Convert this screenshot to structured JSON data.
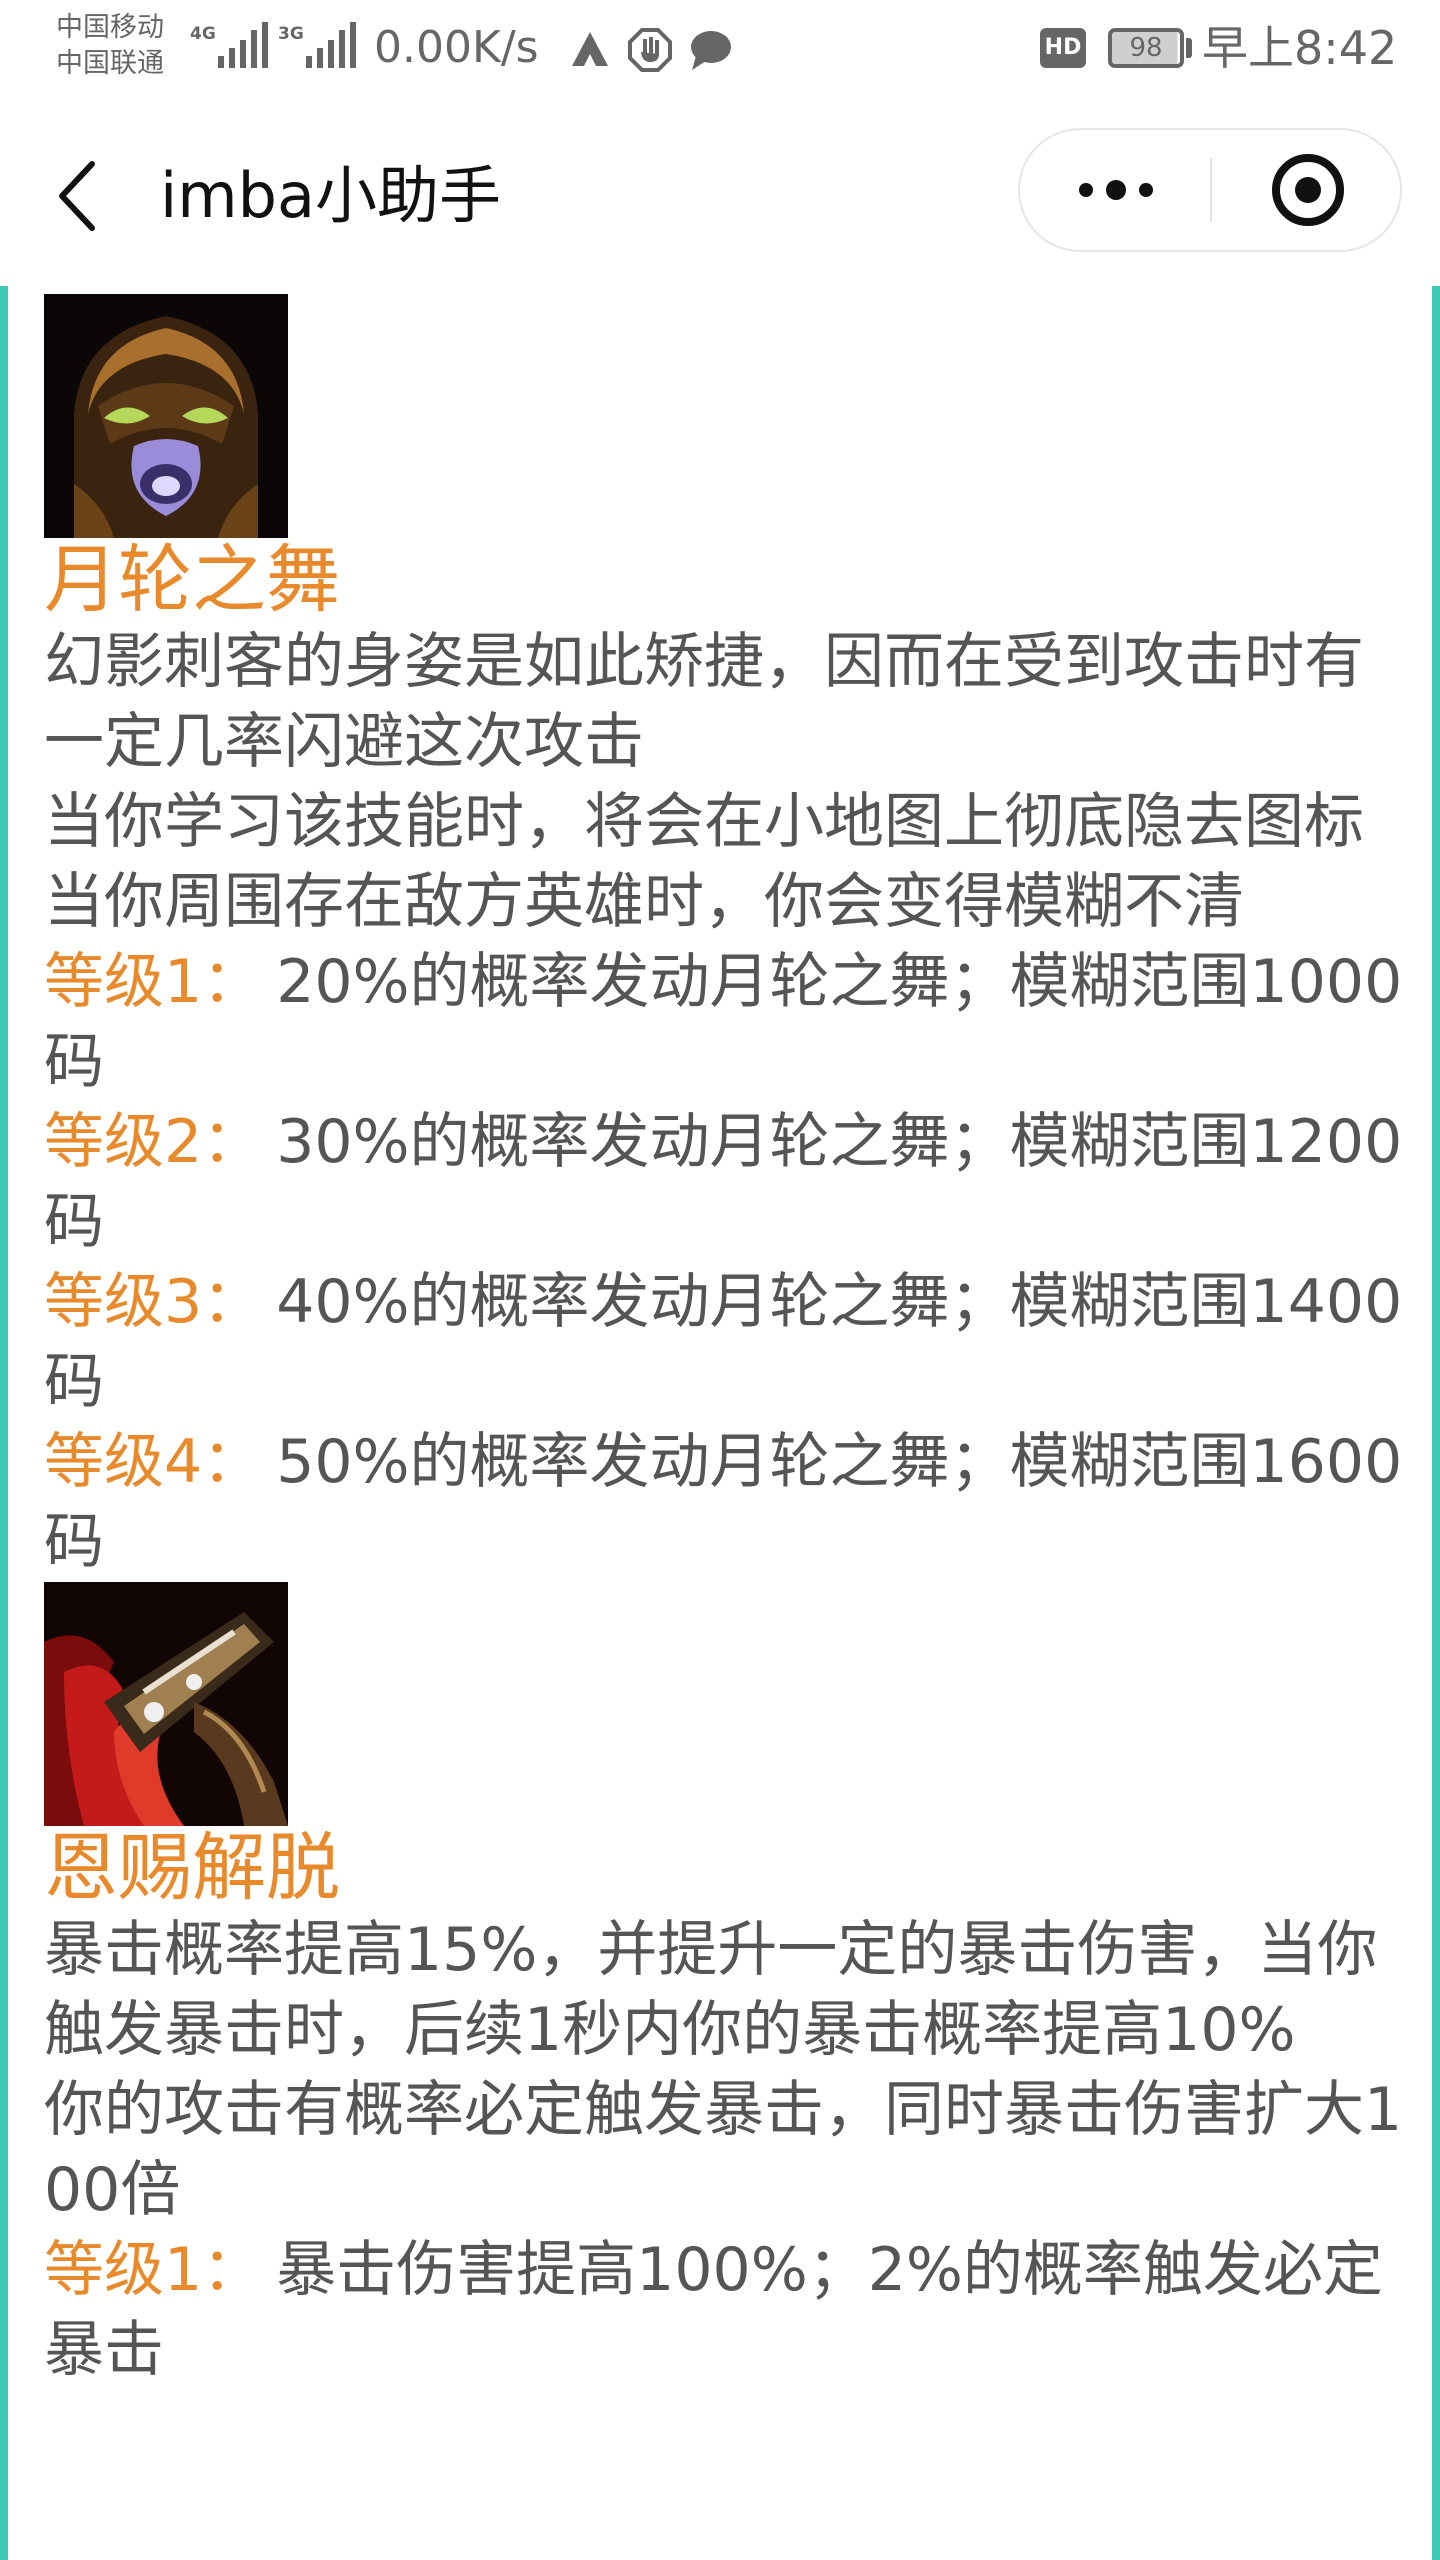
{
  "status_bar": {
    "carrier_1": "中国移动",
    "carrier_2": "中国联通",
    "net_1": "4G",
    "net_2": "3G",
    "speed": "0.00K/s",
    "hd_label": "HD",
    "battery": "98",
    "time": "早上8:42",
    "icons": [
      "signal-icon",
      "signal-icon",
      "arrow-up-icon",
      "hand-icon",
      "chat-bubble-icon"
    ],
    "text_color": "#666666"
  },
  "nav": {
    "title": "imba小助手",
    "back_icon": "chevron-left-icon",
    "more_icon": "more-dots-icon",
    "close_icon": "target-close-icon"
  },
  "colors": {
    "accent": "#e88a2c",
    "body_text": "#555555",
    "rail": "#3cc8b4"
  },
  "skills": [
    {
      "name": "月轮之舞",
      "icon": "masked-assassin-icon",
      "description": [
        "幻影刺客的身姿是如此矫捷，因而在受到攻击时有一定几率闪避这次攻击",
        "当你学习该技能时，将会在小地图上彻底隐去图标",
        "当你周围存在敌方英雄时，你会变得模糊不清"
      ],
      "levels": [
        {
          "label": "等级1：",
          "text": "20%的概率发动月轮之舞；模糊范围1000码"
        },
        {
          "label": "等级2：",
          "text": "30%的概率发动月轮之舞；模糊范围1200码"
        },
        {
          "label": "等级3：",
          "text": "40%的概率发动月轮之舞；模糊范围1400码"
        },
        {
          "label": "等级4：",
          "text": "50%的概率发动月轮之舞；模糊范围1600码"
        }
      ]
    },
    {
      "name": "恩赐解脱",
      "icon": "red-blade-icon",
      "description": [
        "暴击概率提高15%，并提升一定的暴击伤害，当你触发暴击时，后续1秒内你的暴击概率提高10%",
        "你的攻击有概率必定触发暴击，同时暴击伤害扩大100倍"
      ],
      "levels": [
        {
          "label": "等级1：",
          "text": "暴击伤害提高100%；2%的概率触发必定暴击"
        }
      ]
    }
  ]
}
